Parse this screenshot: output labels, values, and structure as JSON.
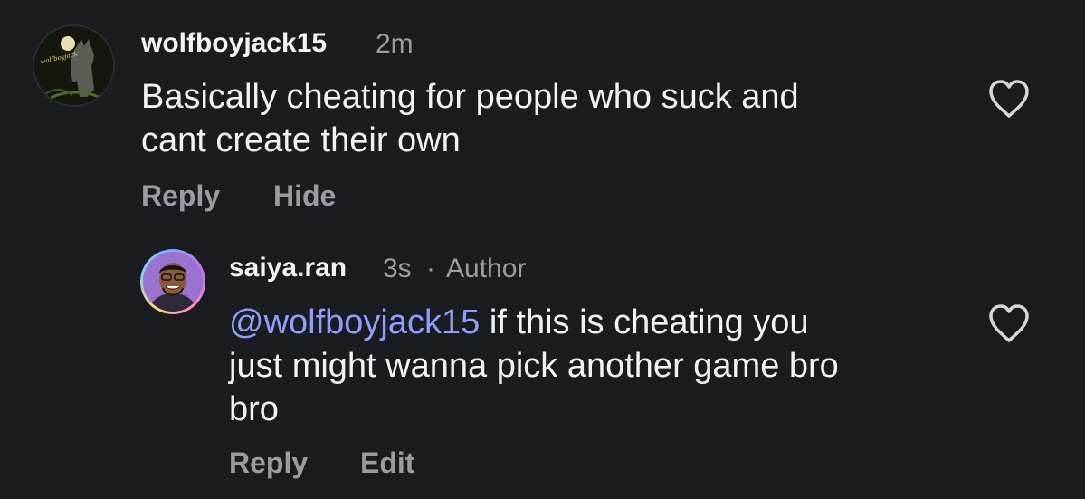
{
  "comments": [
    {
      "username": "wolfboyjack15",
      "time": "2m",
      "avatar_label": "wolfboyjack",
      "text_lines": [
        "Basically cheating for people who suck and",
        "cant create their own"
      ],
      "actions": {
        "reply": "Reply",
        "secondary": "Hide"
      },
      "like_icon": "heart-outline-icon"
    },
    {
      "username": "saiya.ran",
      "time": "3s",
      "separator": "·",
      "badge": "Author",
      "mention": "@wolfboyjack15",
      "text_lines": [
        " if this is cheating you",
        "just might wanna pick another game bro",
        "bro"
      ],
      "actions": {
        "reply": "Reply",
        "secondary": "Edit"
      },
      "like_icon": "heart-outline-icon"
    }
  ],
  "colors": {
    "background": "#1a1c20",
    "text_primary": "#f2f3f5",
    "text_secondary": "#9a9ca3",
    "mention": "#8e9dff"
  }
}
